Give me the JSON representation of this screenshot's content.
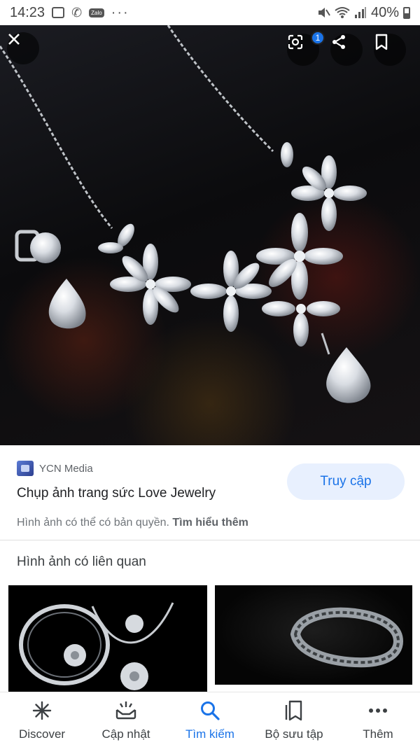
{
  "status_bar": {
    "time": "14:23",
    "battery_text": "40%",
    "icons": [
      "image-icon",
      "phone-wifi-icon",
      "zalo-icon",
      "more-dots-icon",
      "mute-icon",
      "wifi-icon",
      "signal-icon",
      "battery-icon"
    ],
    "zalo_label": "Zalo",
    "more_dots": "···"
  },
  "viewer": {
    "lens_badge": "1",
    "icons": [
      "close-icon",
      "lens-icon",
      "share-icon",
      "bookmark-icon"
    ]
  },
  "result": {
    "source_name": "YCN Media",
    "title": "Chụp ảnh trang sức Love Jewelry",
    "visit_label": "Truy cập",
    "copyright_text": "Hình ảnh có thể có bản quyền.",
    "learn_more": "Tìm hiểu thêm"
  },
  "related": {
    "heading": "Hình ảnh có liên quan"
  },
  "bottom_nav": {
    "items": [
      {
        "label": "Discover",
        "icon": "asterisk-icon",
        "active": false
      },
      {
        "label": "Cập nhật",
        "icon": "updates-icon",
        "active": false
      },
      {
        "label": "Tìm kiếm",
        "icon": "search-icon",
        "active": true
      },
      {
        "label": "Bộ sưu tập",
        "icon": "collections-icon",
        "active": false
      },
      {
        "label": "Thêm",
        "icon": "more-icon",
        "active": false
      }
    ],
    "active_color": "#1a73e8"
  },
  "colors": {
    "accent": "#1a73e8",
    "visit_button_bg": "#e8f0fe"
  }
}
